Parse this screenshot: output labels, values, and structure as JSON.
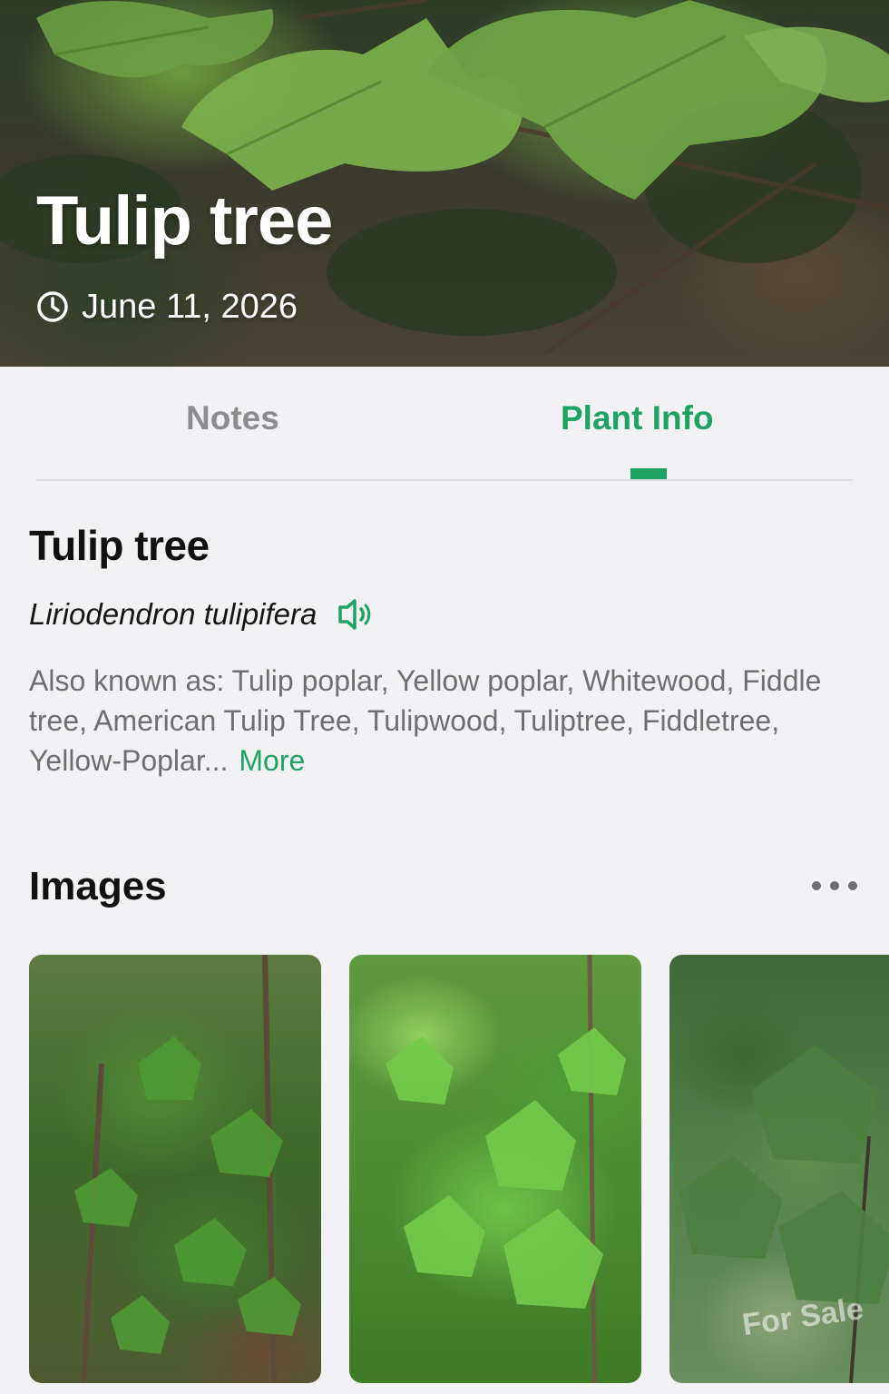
{
  "header": {
    "title": "Tulip tree",
    "date": "June 11, 2026"
  },
  "tabs": [
    {
      "label": "Notes",
      "active": false
    },
    {
      "label": "Plant Info",
      "active": true
    }
  ],
  "plant": {
    "common_name": "Tulip tree",
    "scientific_name": "Liriodendron tulipifera",
    "also_known_as": "Also known as: Tulip poplar, Yellow poplar, Whitewood, Fiddle tree, American Tulip Tree, Tulipwood, Tuliptree, Fiddletree, Yellow-Poplar...",
    "more_label": "More"
  },
  "images_section": {
    "title": "Images",
    "watermark": "For Sale"
  },
  "icons": {
    "date": "clock-icon",
    "pronunciation": "speaker-icon",
    "options": "more-dots-icon"
  },
  "colors": {
    "accent": "#1ea362",
    "inactive_tab": "#8d8d90",
    "body_text": "#6f6f72",
    "background": "#f2f1f3"
  }
}
